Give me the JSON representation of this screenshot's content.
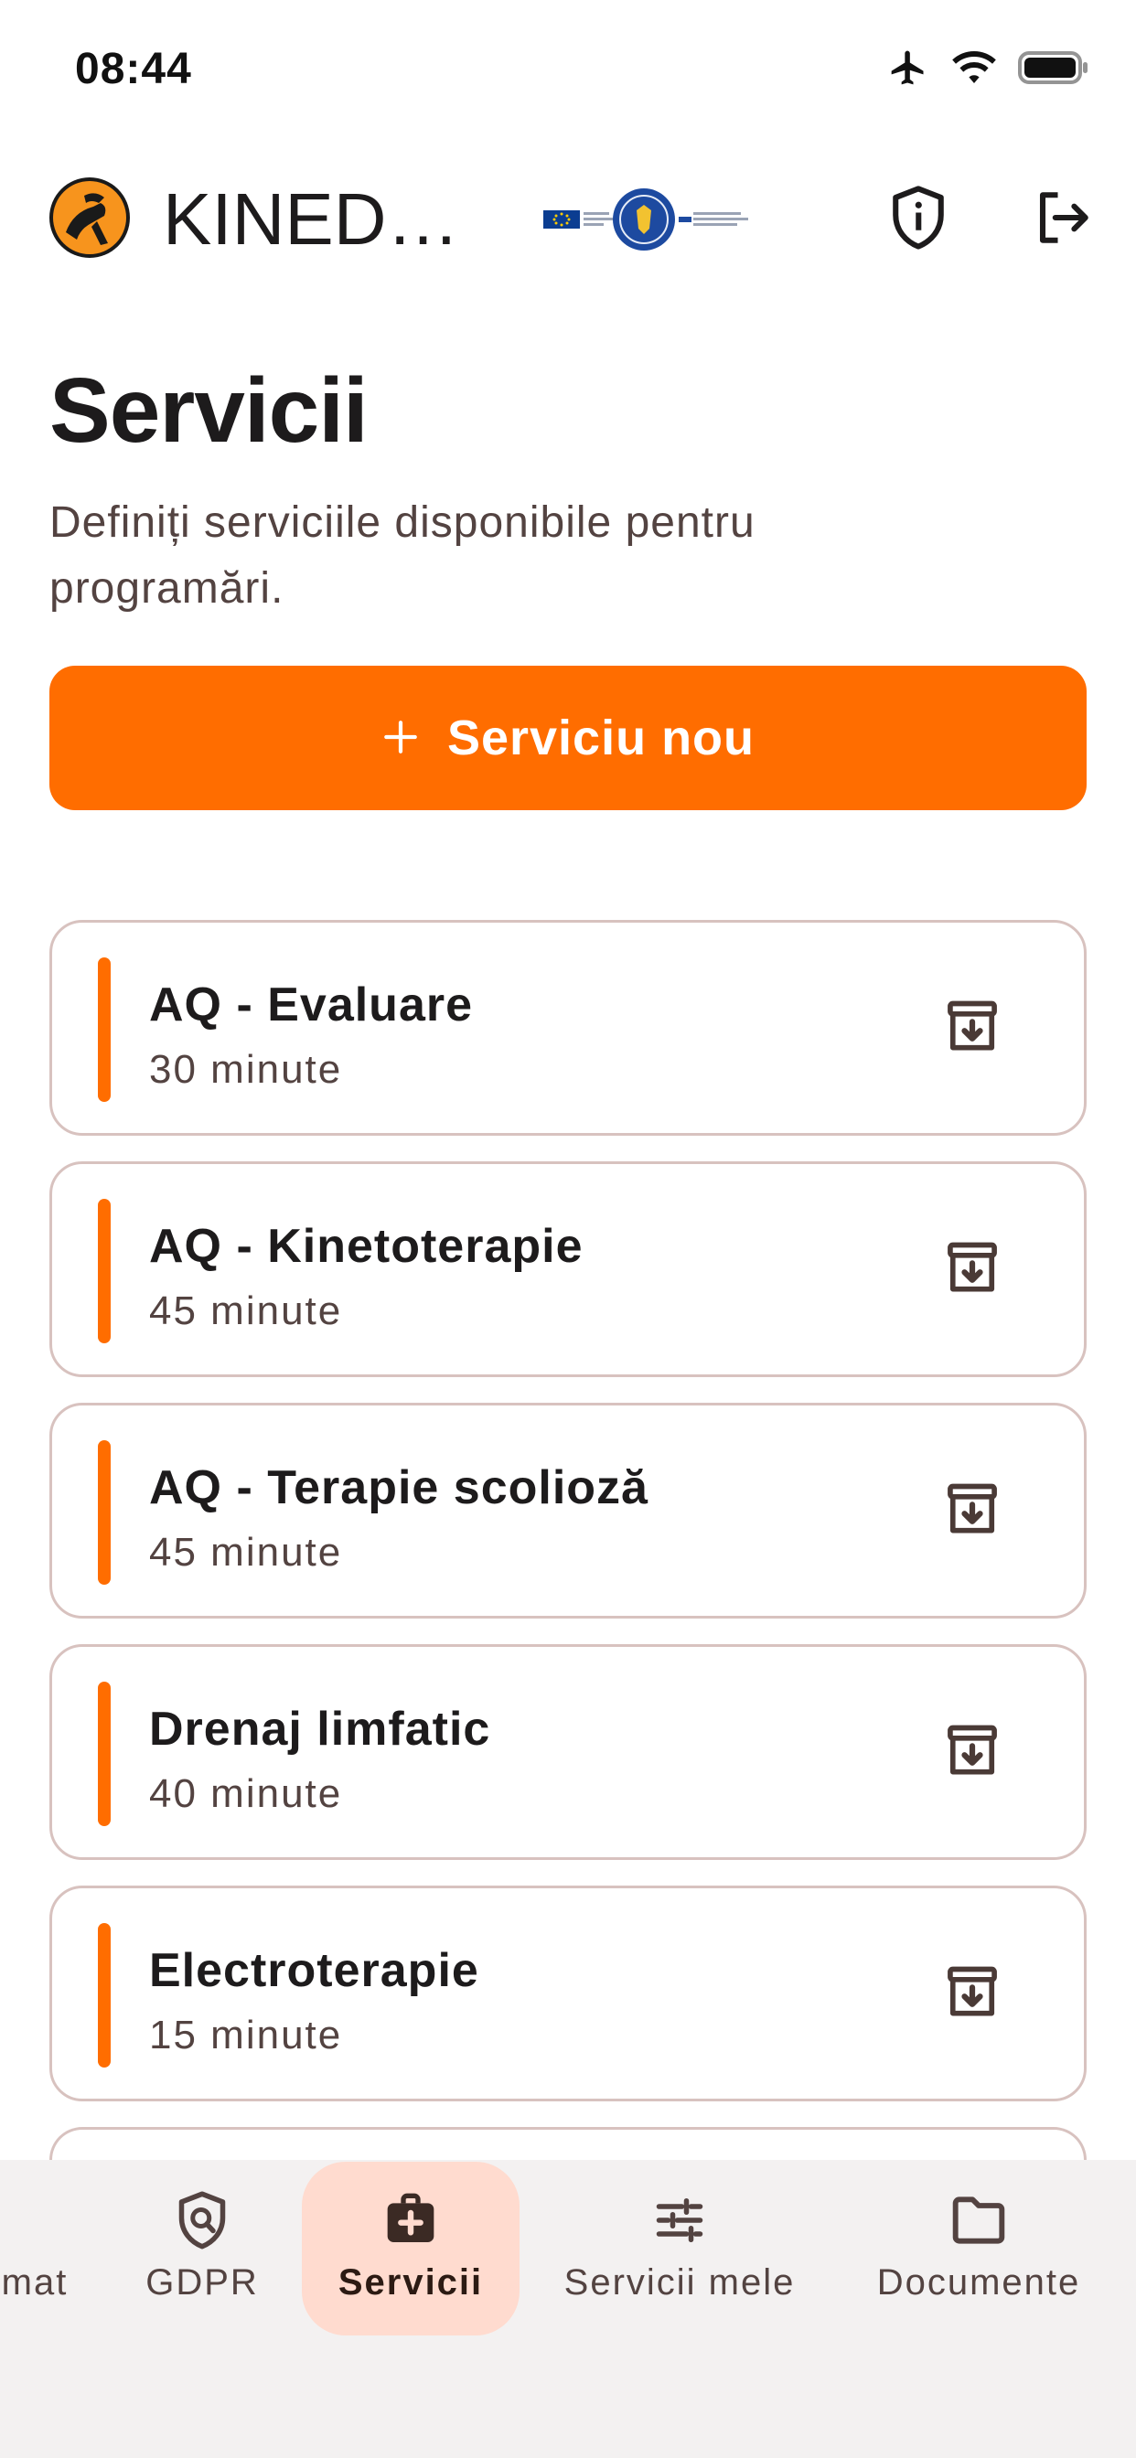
{
  "status_bar": {
    "time": "08:44"
  },
  "header": {
    "app_name": "KINEDB..."
  },
  "page": {
    "title": "Servicii",
    "subtitle": "Definiți serviciile disponibile pentru programări."
  },
  "actions": {
    "new_service_label": "Serviciu nou",
    "new_service_icon": "plus-icon"
  },
  "services": [
    {
      "name": "AQ - Evaluare",
      "duration": "30 minute"
    },
    {
      "name": "AQ - Kinetoterapie",
      "duration": "45 minute"
    },
    {
      "name": "AQ - Terapie scolioză",
      "duration": "45 minute"
    },
    {
      "name": "Drenaj limfatic",
      "duration": "40 minute"
    },
    {
      "name": "Electroterapie",
      "duration": "15 minute"
    }
  ],
  "bottom_nav": {
    "items": [
      {
        "label": "mat",
        "icon": "partial-icon",
        "active": false
      },
      {
        "label": "GDPR",
        "icon": "shield-search-icon",
        "active": false
      },
      {
        "label": "Servicii",
        "icon": "medical-bag-icon",
        "active": true
      },
      {
        "label": "Servicii mele",
        "icon": "sliders-icon",
        "active": false
      },
      {
        "label": "Documente",
        "icon": "folder-icon",
        "active": false
      }
    ]
  },
  "colors": {
    "accent": "#ff6d00",
    "card_border": "#d8c2bf",
    "active_nav_bg": "#ffdbcf",
    "nav_bg": "#f3f1f1",
    "text_primary": "#1d1b1c",
    "text_secondary": "#534341"
  }
}
